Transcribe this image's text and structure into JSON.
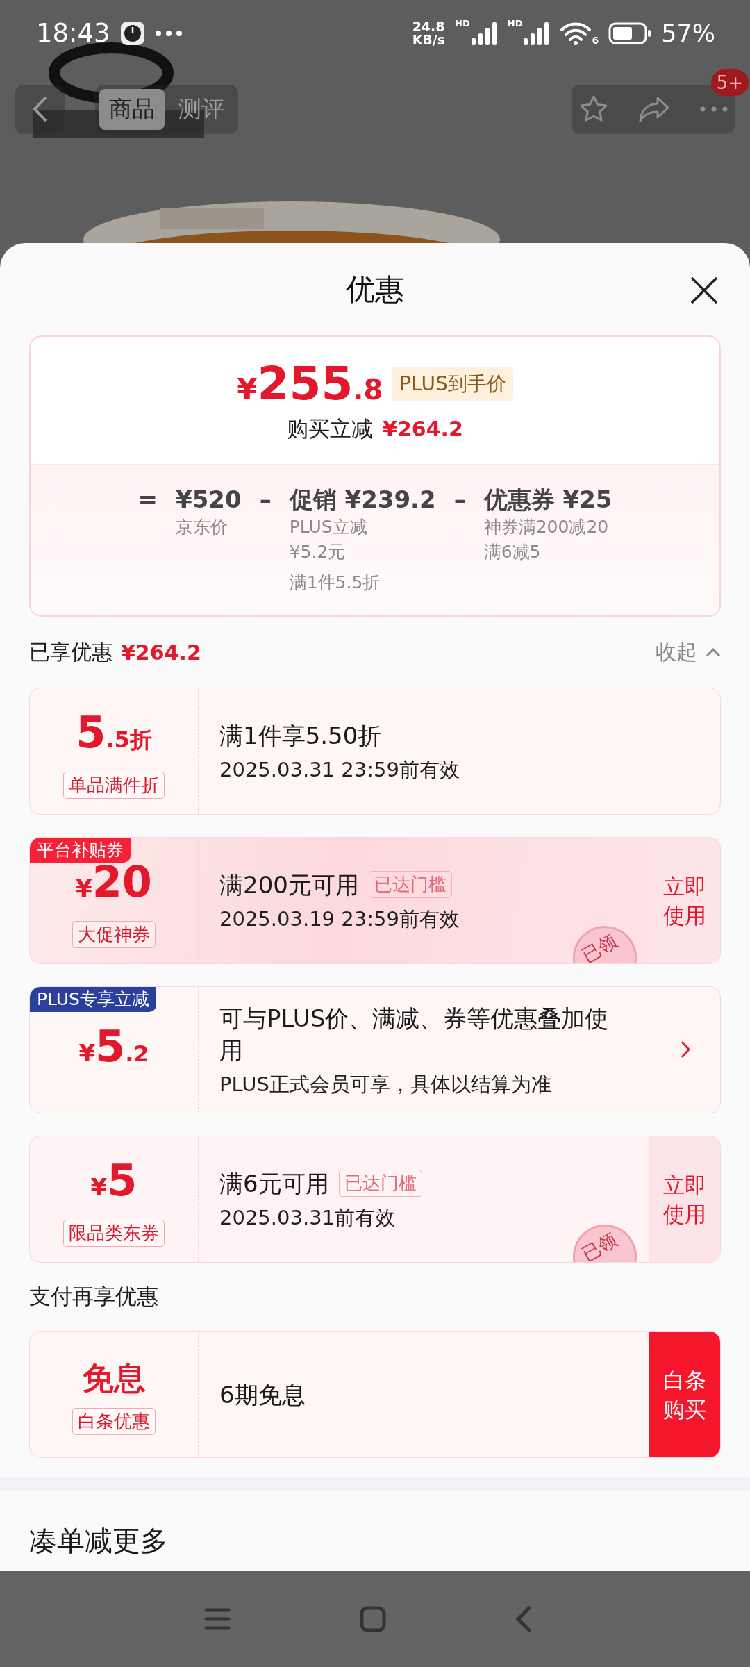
{
  "status_bar": {
    "time": "18:43",
    "net_speed": [
      "24.8",
      "KB/s"
    ],
    "sim_labels": [
      "HD",
      "HD"
    ],
    "wifi_label": "6",
    "battery": "57%"
  },
  "header": {
    "tabs": [
      {
        "label": "商品",
        "selected": true
      },
      {
        "label": "测评",
        "selected": false
      }
    ],
    "badge": "5+"
  },
  "sheet": {
    "title": "优惠",
    "summary": {
      "price": {
        "currency": "¥",
        "integer": "255",
        "decimal": ".8"
      },
      "price_tag": "PLUS到手价",
      "saving_label": "购买立减",
      "saving_amount": "¥264.2",
      "breakdown": [
        {
          "operator": "=",
          "amount": "¥520",
          "notes": [
            "京东价"
          ]
        },
        {
          "operator": "–",
          "amount": "促销 ¥239.2",
          "notes": [
            "PLUS立减",
            "¥5.2元",
            "满1件5.5折"
          ]
        },
        {
          "operator": "–",
          "amount": "优惠券 ¥25",
          "notes": [
            "神券满200减20",
            "满6减5"
          ]
        }
      ]
    },
    "enjoyed": {
      "label": "已享优惠",
      "amount": "¥264.2",
      "toggle": "收起",
      "expanded": true
    },
    "offers": [
      {
        "kind": "discount",
        "amount": "5",
        "fraction": ".5折",
        "tag": "单品满件折",
        "title": "满1件享5.50折",
        "validity": "2025.03.31 23:59前有效",
        "chevron": false
      },
      {
        "kind": "featured_coupon",
        "ribbon": {
          "text": "平台补贴券",
          "color": "#f42139"
        },
        "currency": "¥",
        "amount": "20",
        "tag": "大促神券",
        "title": "满200元可用",
        "threshold": "已达门槛",
        "validity": "2025.03.19 23:59前有效",
        "stamp": "已领",
        "action": {
          "text": "立即使用"
        },
        "chevron": false
      },
      {
        "kind": "plus",
        "ribbon": {
          "text": "PLUS专享立减",
          "color": "#2b3f9e"
        },
        "currency": "¥",
        "amount": "5",
        "fraction": ".2",
        "title": "可与PLUS价、满减、券等优惠叠加使用",
        "validity": "PLUS正式会员可享，具体以结算为准",
        "chevron": true
      },
      {
        "kind": "coupon",
        "currency": "¥",
        "amount": "5",
        "tag": "限品类东券",
        "title": "满6元可用",
        "threshold": "已达门槛",
        "validity": "2025.03.31前有效",
        "stamp": "已领",
        "action": {
          "text": "立即使用"
        },
        "chevron": false
      }
    ],
    "payment_heading": "支付再享优惠",
    "payment_offers": [
      {
        "kind": "payment",
        "amount": "免息",
        "tag": "白条优惠",
        "title": "6期免息",
        "action": {
          "text": "白条购买"
        },
        "chevron": false
      }
    ],
    "more_heading": "凑单减更多"
  }
}
